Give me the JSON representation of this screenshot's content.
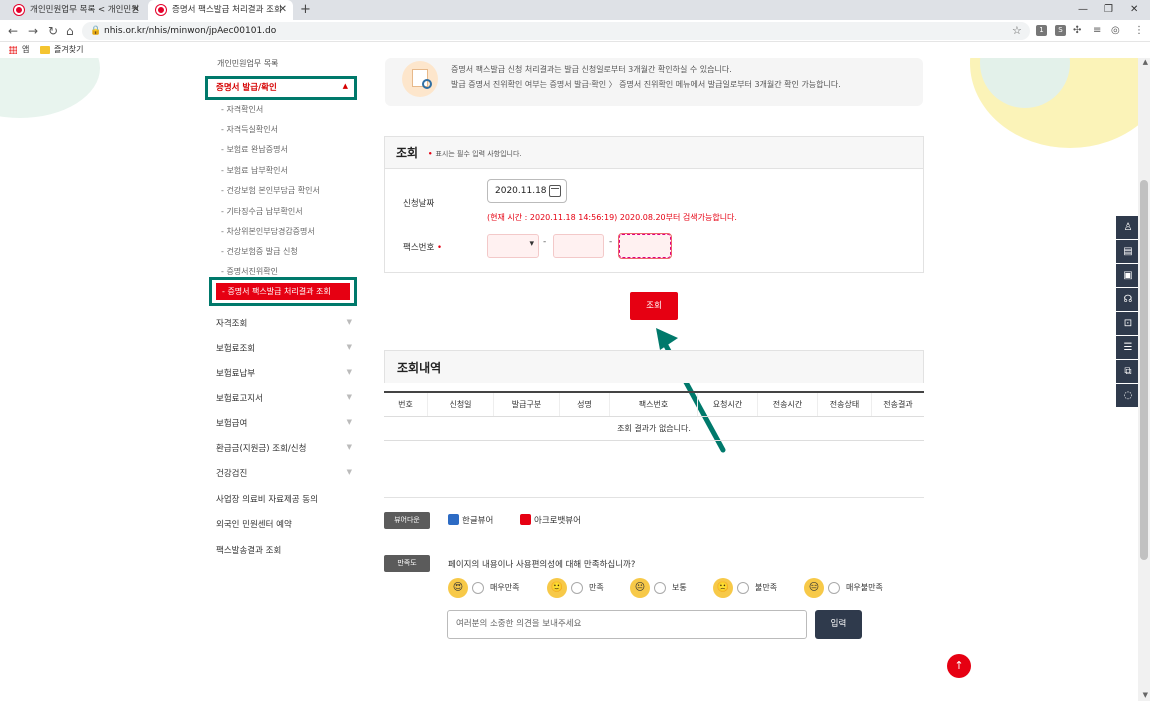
{
  "browser": {
    "tabs": [
      {
        "label": "개인민원업무 목록 < 개인민원"
      },
      {
        "label": "증명서 팩스발급 처리결과 조회"
      }
    ],
    "new_tab": "+",
    "url": "nhis.or.kr/nhis/minwon/jpAec00101.do",
    "ext_icons": [
      "1",
      "S"
    ],
    "bookmarks": [
      {
        "label": "앱"
      },
      {
        "label": "즐겨찾기"
      }
    ]
  },
  "notice": {
    "line1": "증명서 팩스발급 신청 처리결과는 발급 신청일로부터 3개월간 확인하실 수 있습니다.",
    "line2": "발급 증명서 진위확인 여부는 증명서 발급·확인 〉 증명서 진위확인 메뉴에서 발급일로부터 3개월간 확인 가능합니다."
  },
  "sidebar": {
    "top_label": "개인민원업무 목록",
    "section_label": "증명서 발급/확인",
    "sub_items": [
      "자격확인서",
      "자격득실확인서",
      "보험료 완납증명서",
      "보험료 납부확인서",
      "건강보험 본인부담금 확인서",
      "기타징수금 납부확인서",
      "차상위본인부담경감증명서",
      "건강보험증 발급 신청",
      "증명서진위확인"
    ],
    "active_item": "증명서 팩스발급 처리결과 조회",
    "main_items": [
      "자격조회",
      "보험료조회",
      "보험료납부",
      "보험료고지서",
      "보험급여",
      "환급금(지원금) 조회/신청",
      "건강검진",
      "사업장 의료비 자료제공 동의",
      "외국인 민원센터 예약",
      "팩스발송결과 조회"
    ]
  },
  "query": {
    "title": "조회",
    "required_note": "표시는 필수 입력 사항입니다.",
    "date_label": "신청날짜",
    "date_value": "2020.11.18",
    "hint": "(현재 시간 : 2020.11.18 14:56:19) 2020.08.20부터 검색가능합니다.",
    "fax_label": "팩스번호",
    "dash": "-",
    "search_button": "조회"
  },
  "results": {
    "title": "조회내역",
    "columns": [
      "번호",
      "신청일",
      "발급구분",
      "성명",
      "팩스번호",
      "요청시간",
      "전송시간",
      "전송상태",
      "전송결과"
    ],
    "empty_message": "조회 결과가 없습니다."
  },
  "viewer": {
    "pill": "뷰어다운",
    "hwp": "한글뷰어",
    "acrobat": "아크로뱃뷰어"
  },
  "survey": {
    "pill": "만족도",
    "question": "페이지의 내용이나 사용편의성에 대해 만족하십니까?",
    "options": [
      "매우만족",
      "만족",
      "보통",
      "불만족",
      "매우불만족"
    ],
    "placeholder": "여러분의 소중한 의견을 보내주세요",
    "submit": "입력"
  },
  "colors": {
    "accent_red": "#e60012",
    "annotation_teal": "#00796b",
    "dark_button": "#2f3a4c"
  }
}
